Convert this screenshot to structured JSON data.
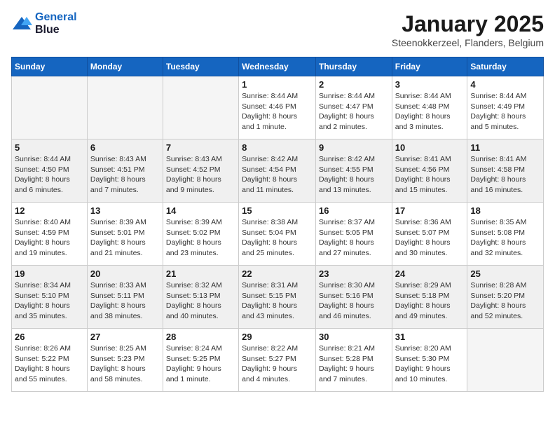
{
  "logo": {
    "line1": "General",
    "line2": "Blue"
  },
  "title": "January 2025",
  "location": "Steenokkerzeel, Flanders, Belgium",
  "weekdays": [
    "Sunday",
    "Monday",
    "Tuesday",
    "Wednesday",
    "Thursday",
    "Friday",
    "Saturday"
  ],
  "weeks": [
    [
      {
        "day": "",
        "info": ""
      },
      {
        "day": "",
        "info": ""
      },
      {
        "day": "",
        "info": ""
      },
      {
        "day": "1",
        "info": "Sunrise: 8:44 AM\nSunset: 4:46 PM\nDaylight: 8 hours\nand 1 minute."
      },
      {
        "day": "2",
        "info": "Sunrise: 8:44 AM\nSunset: 4:47 PM\nDaylight: 8 hours\nand 2 minutes."
      },
      {
        "day": "3",
        "info": "Sunrise: 8:44 AM\nSunset: 4:48 PM\nDaylight: 8 hours\nand 3 minutes."
      },
      {
        "day": "4",
        "info": "Sunrise: 8:44 AM\nSunset: 4:49 PM\nDaylight: 8 hours\nand 5 minutes."
      }
    ],
    [
      {
        "day": "5",
        "info": "Sunrise: 8:44 AM\nSunset: 4:50 PM\nDaylight: 8 hours\nand 6 minutes."
      },
      {
        "day": "6",
        "info": "Sunrise: 8:43 AM\nSunset: 4:51 PM\nDaylight: 8 hours\nand 7 minutes."
      },
      {
        "day": "7",
        "info": "Sunrise: 8:43 AM\nSunset: 4:52 PM\nDaylight: 8 hours\nand 9 minutes."
      },
      {
        "day": "8",
        "info": "Sunrise: 8:42 AM\nSunset: 4:54 PM\nDaylight: 8 hours\nand 11 minutes."
      },
      {
        "day": "9",
        "info": "Sunrise: 8:42 AM\nSunset: 4:55 PM\nDaylight: 8 hours\nand 13 minutes."
      },
      {
        "day": "10",
        "info": "Sunrise: 8:41 AM\nSunset: 4:56 PM\nDaylight: 8 hours\nand 15 minutes."
      },
      {
        "day": "11",
        "info": "Sunrise: 8:41 AM\nSunset: 4:58 PM\nDaylight: 8 hours\nand 16 minutes."
      }
    ],
    [
      {
        "day": "12",
        "info": "Sunrise: 8:40 AM\nSunset: 4:59 PM\nDaylight: 8 hours\nand 19 minutes."
      },
      {
        "day": "13",
        "info": "Sunrise: 8:39 AM\nSunset: 5:01 PM\nDaylight: 8 hours\nand 21 minutes."
      },
      {
        "day": "14",
        "info": "Sunrise: 8:39 AM\nSunset: 5:02 PM\nDaylight: 8 hours\nand 23 minutes."
      },
      {
        "day": "15",
        "info": "Sunrise: 8:38 AM\nSunset: 5:04 PM\nDaylight: 8 hours\nand 25 minutes."
      },
      {
        "day": "16",
        "info": "Sunrise: 8:37 AM\nSunset: 5:05 PM\nDaylight: 8 hours\nand 27 minutes."
      },
      {
        "day": "17",
        "info": "Sunrise: 8:36 AM\nSunset: 5:07 PM\nDaylight: 8 hours\nand 30 minutes."
      },
      {
        "day": "18",
        "info": "Sunrise: 8:35 AM\nSunset: 5:08 PM\nDaylight: 8 hours\nand 32 minutes."
      }
    ],
    [
      {
        "day": "19",
        "info": "Sunrise: 8:34 AM\nSunset: 5:10 PM\nDaylight: 8 hours\nand 35 minutes."
      },
      {
        "day": "20",
        "info": "Sunrise: 8:33 AM\nSunset: 5:11 PM\nDaylight: 8 hours\nand 38 minutes."
      },
      {
        "day": "21",
        "info": "Sunrise: 8:32 AM\nSunset: 5:13 PM\nDaylight: 8 hours\nand 40 minutes."
      },
      {
        "day": "22",
        "info": "Sunrise: 8:31 AM\nSunset: 5:15 PM\nDaylight: 8 hours\nand 43 minutes."
      },
      {
        "day": "23",
        "info": "Sunrise: 8:30 AM\nSunset: 5:16 PM\nDaylight: 8 hours\nand 46 minutes."
      },
      {
        "day": "24",
        "info": "Sunrise: 8:29 AM\nSunset: 5:18 PM\nDaylight: 8 hours\nand 49 minutes."
      },
      {
        "day": "25",
        "info": "Sunrise: 8:28 AM\nSunset: 5:20 PM\nDaylight: 8 hours\nand 52 minutes."
      }
    ],
    [
      {
        "day": "26",
        "info": "Sunrise: 8:26 AM\nSunset: 5:22 PM\nDaylight: 8 hours\nand 55 minutes."
      },
      {
        "day": "27",
        "info": "Sunrise: 8:25 AM\nSunset: 5:23 PM\nDaylight: 8 hours\nand 58 minutes."
      },
      {
        "day": "28",
        "info": "Sunrise: 8:24 AM\nSunset: 5:25 PM\nDaylight: 9 hours\nand 1 minute."
      },
      {
        "day": "29",
        "info": "Sunrise: 8:22 AM\nSunset: 5:27 PM\nDaylight: 9 hours\nand 4 minutes."
      },
      {
        "day": "30",
        "info": "Sunrise: 8:21 AM\nSunset: 5:28 PM\nDaylight: 9 hours\nand 7 minutes."
      },
      {
        "day": "31",
        "info": "Sunrise: 8:20 AM\nSunset: 5:30 PM\nDaylight: 9 hours\nand 10 minutes."
      },
      {
        "day": "",
        "info": ""
      }
    ]
  ]
}
